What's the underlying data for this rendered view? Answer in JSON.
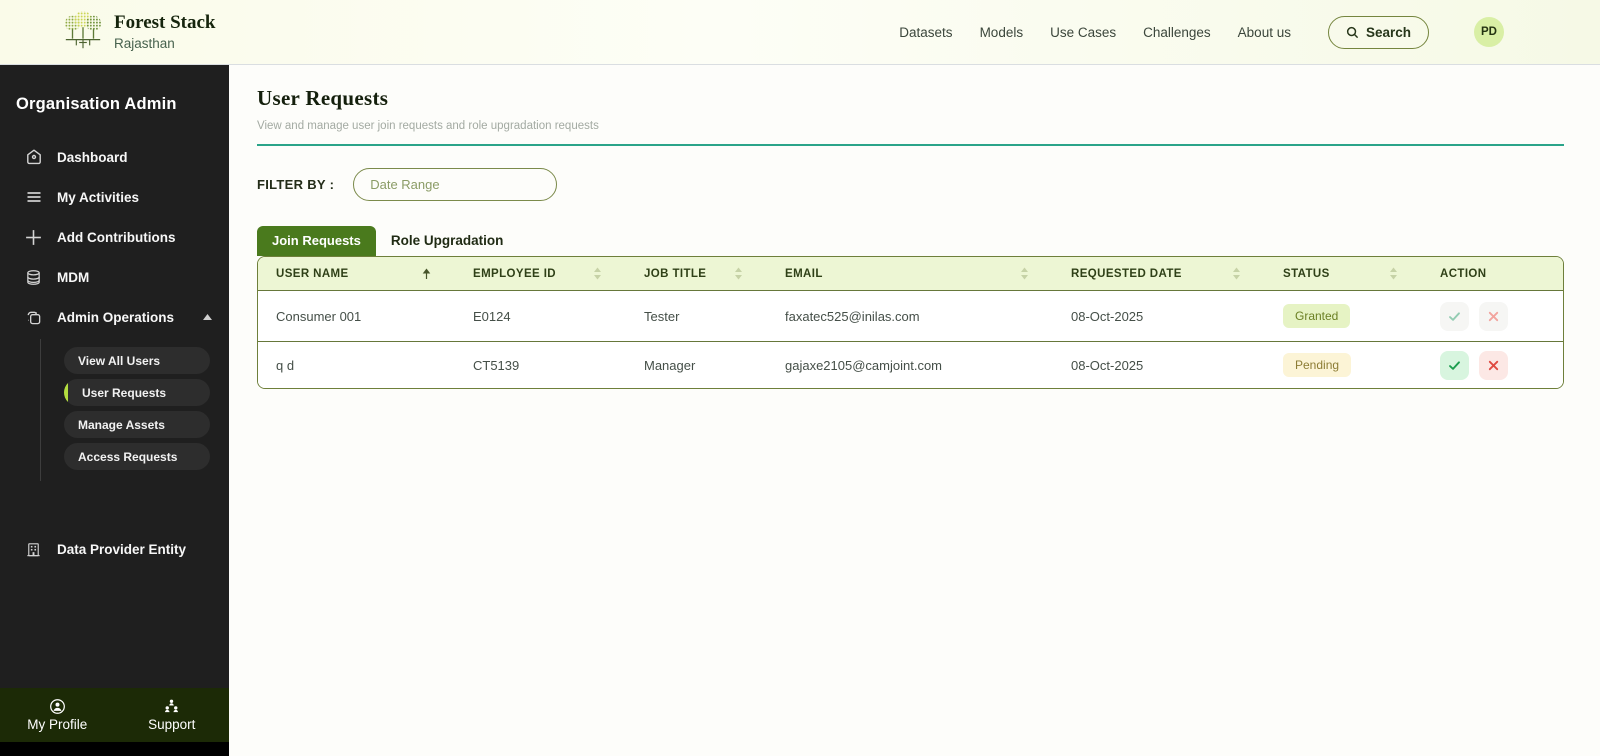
{
  "header": {
    "brand": {
      "title": "Forest Stack",
      "subtitle": "Rajasthan"
    },
    "nav": [
      "Datasets",
      "Models",
      "Use Cases",
      "Challenges",
      "About us"
    ],
    "search_label": "Search",
    "avatar_initials": "PD"
  },
  "sidebar": {
    "title": "Organisation Admin",
    "items": [
      {
        "label": "Dashboard"
      },
      {
        "label": "My Activities"
      },
      {
        "label": "Add Contributions"
      },
      {
        "label": "MDM"
      },
      {
        "label": "Admin Operations"
      }
    ],
    "admin_submenu": [
      "View All Users",
      "User Requests",
      "Manage Assets",
      "Access Requests"
    ],
    "active_submenu": "User Requests",
    "data_provider_label": "Data Provider Entity",
    "footer": [
      {
        "label": "My Profile"
      },
      {
        "label": "Support"
      }
    ]
  },
  "page": {
    "title": "User Requests",
    "subtitle": "View and manage user join requests and role upgradation requests",
    "filter_label": "FILTER BY :",
    "date_range_placeholder": "Date Range",
    "tabs": [
      "Join Requests",
      "Role Upgradation"
    ],
    "active_tab": "Join Requests"
  },
  "table": {
    "columns": [
      "USER NAME",
      "EMPLOYEE ID",
      "JOB TITLE",
      "EMAIL",
      "REQUESTED DATE",
      "STATUS",
      "ACTION"
    ],
    "sorted_column": "USER NAME",
    "rows": [
      {
        "user_name": "Consumer 001",
        "employee_id": "E0124",
        "job_title": "Tester",
        "email": "faxatec525@inilas.com",
        "requested_date": "08-Oct-2025",
        "status": "Granted"
      },
      {
        "user_name": "q d",
        "employee_id": "CT5139",
        "job_title": "Manager",
        "email": "gajaxe2105@camjoint.com",
        "requested_date": "08-Oct-2025",
        "status": "Pending"
      }
    ]
  },
  "colors": {
    "tab_active_green": "#4a7a1d",
    "accent_lime": "#b3dd3f",
    "teal_divider": "#2aa489",
    "table_border": "#6e7f3a",
    "thead_bg": "#edf6d4",
    "granted_bg": "#e6f3c4",
    "pending_bg": "#fcf4d6",
    "approve_green": "#1c9e4e",
    "reject_red": "#df4b42",
    "sidebar_bg": "#1f1f1f",
    "sidebar_footer_bg": "#1c2a06"
  }
}
